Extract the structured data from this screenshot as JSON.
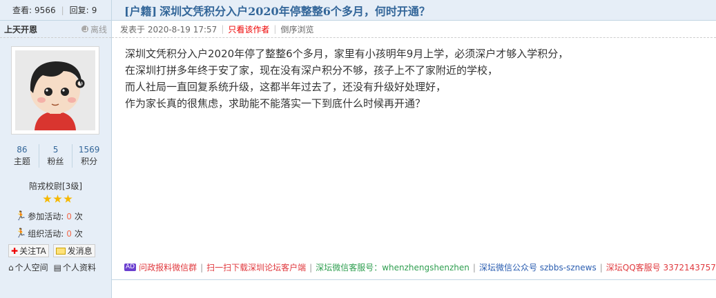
{
  "stats": {
    "views_label": "查看:",
    "views": "9566",
    "replies_label": "回复:",
    "replies": "9"
  },
  "thread": {
    "category": "[户籍]",
    "title": "深圳文凭积分入户2020年停整整6个多月，何时开通？"
  },
  "author": {
    "name": "上天开恩",
    "status": "离线"
  },
  "meta": {
    "posted": "发表于 2020-8-19 17:57",
    "only_author": "只看该作者",
    "reverse": "倒序浏览"
  },
  "user_counts": [
    {
      "value": "86",
      "label": "主题"
    },
    {
      "value": "5",
      "label": "粉丝"
    },
    {
      "value": "1569",
      "label": "积分"
    }
  ],
  "rank": "陪戎校尉[3级]",
  "stars": 3,
  "activities": [
    {
      "label": "参加活动:",
      "count": "0",
      "unit": "次"
    },
    {
      "label": "组织活动:",
      "count": "0",
      "unit": "次"
    }
  ],
  "buttons": {
    "follow": "关注TA",
    "message": "发消息"
  },
  "links": {
    "space": "个人空间",
    "profile": "个人资料"
  },
  "post_lines": [
    "深圳文凭积分入户2020年停了整整6个多月，家里有小孩明年9月上学，必须深户才够入学积分，",
    "在深圳打拼多年终于安了家，现在没有深户积分不够，孩子上不了家附近的学校，",
    "而人社局一直回复系统升级，这都半年过去了，还没有升级好处理好，",
    "作为家长真的很焦虑，求助能不能落实一下到底什么时候再开通？"
  ],
  "footer": {
    "ad": "AD",
    "items": [
      {
        "text": "问政报料微信群",
        "color": "#e0393e"
      },
      {
        "text": "扫一扫下载深圳论坛客户端",
        "color": "#e0393e"
      },
      {
        "text": "深坛微信客服号：whenzhengshenzhen",
        "color": "#2e9e4f"
      },
      {
        "text": "深坛微信公众号 szbbs-sznews",
        "color": "#2a5db0"
      },
      {
        "text": "深坛QQ客服号 3372143757",
        "color": "#e0393e"
      }
    ]
  }
}
